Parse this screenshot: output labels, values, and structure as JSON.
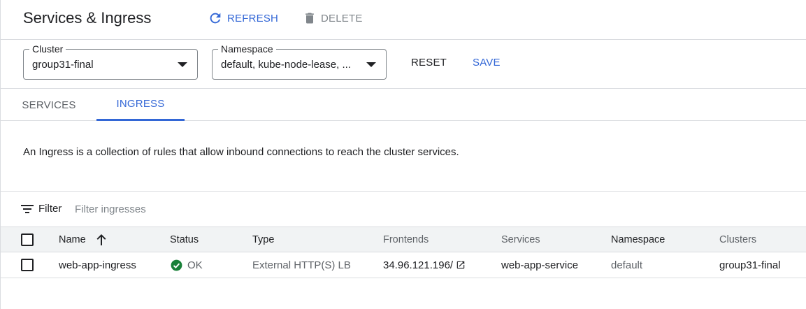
{
  "header": {
    "title": "Services & Ingress",
    "refresh_label": "REFRESH",
    "delete_label": "DELETE"
  },
  "filters": {
    "cluster": {
      "label": "Cluster",
      "value": "group31-final"
    },
    "namespace": {
      "label": "Namespace",
      "value": "default, kube-node-lease, ..."
    },
    "reset_label": "RESET",
    "save_label": "SAVE"
  },
  "tabs": [
    {
      "label": "SERVICES",
      "active": false
    },
    {
      "label": "INGRESS",
      "active": true
    }
  ],
  "description": "An Ingress is a collection of rules that allow inbound connections to reach the cluster services.",
  "filter_bar": {
    "label": "Filter",
    "placeholder": "Filter ingresses"
  },
  "table": {
    "columns": [
      "Name",
      "Status",
      "Type",
      "Frontends",
      "Services",
      "Namespace",
      "Clusters"
    ],
    "sort_column": "Name",
    "rows": [
      {
        "name": "web-app-ingress",
        "status": "OK",
        "type": "External HTTP(S) LB",
        "frontend": "34.96.121.196/",
        "service": "web-app-service",
        "namespace": "default",
        "cluster": "group31-final"
      }
    ]
  },
  "colors": {
    "accent": "#3367d6",
    "ok_green": "#188038",
    "border": "#dadce0",
    "header_bg": "#f1f3f4"
  },
  "icons": {
    "refresh": "refresh-icon",
    "delete": "trash-icon",
    "filter": "filter-lines-icon",
    "sort": "arrow-up-icon",
    "status_ok": "check-circle-icon",
    "external_link": "open-in-new-icon"
  }
}
